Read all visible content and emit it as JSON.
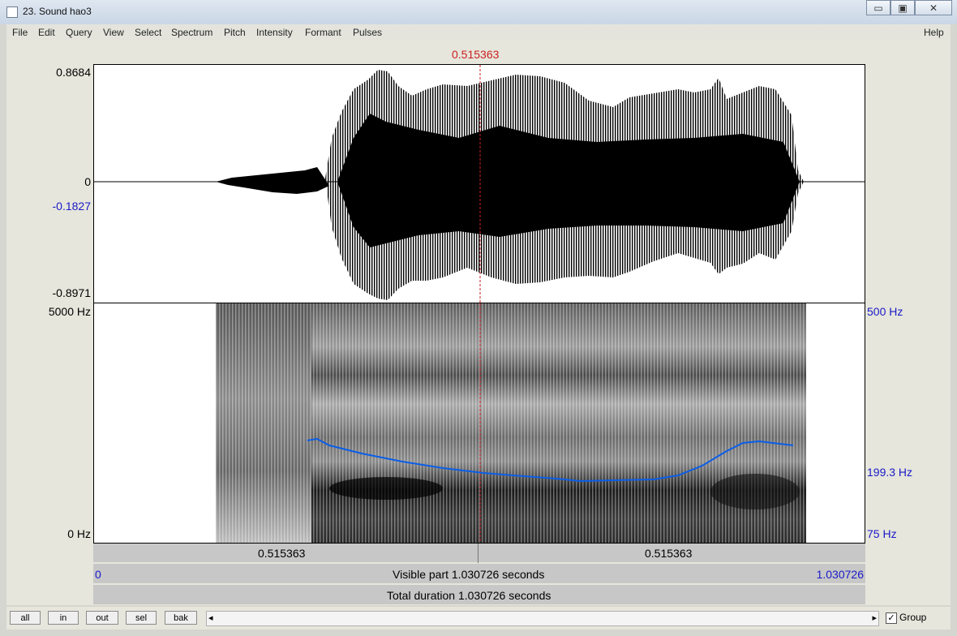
{
  "window": {
    "title": "23. Sound hao3",
    "minimize": "▭",
    "maximize": "▣",
    "close": "✕"
  },
  "menu": [
    "File",
    "Edit",
    "Query",
    "View",
    "Select",
    "Spectrum",
    "Pitch",
    "Intensity",
    "Formant",
    "Pulses"
  ],
  "help": "Help",
  "cursor": {
    "time": "0.515363"
  },
  "waveform": {
    "max": "0.8684",
    "zero": "0",
    "cursor_value": "-0.1827",
    "min": "-0.8971"
  },
  "spectrogram": {
    "freq_max": "5000 Hz",
    "freq_min": "0 Hz"
  },
  "pitch": {
    "max": "500 Hz",
    "current": "199.3 Hz",
    "min": "75 Hz"
  },
  "time_bar": {
    "left": "0.515363",
    "right": "0.515363"
  },
  "visible_bar": {
    "start": "0",
    "label": "Visible part 1.030726 seconds",
    "end": "1.030726"
  },
  "total_bar": {
    "label": "Total duration 1.030726 seconds"
  },
  "buttons": [
    "all",
    "in",
    "out",
    "sel",
    "bak"
  ],
  "group": {
    "label": "Group",
    "checked": true
  }
}
